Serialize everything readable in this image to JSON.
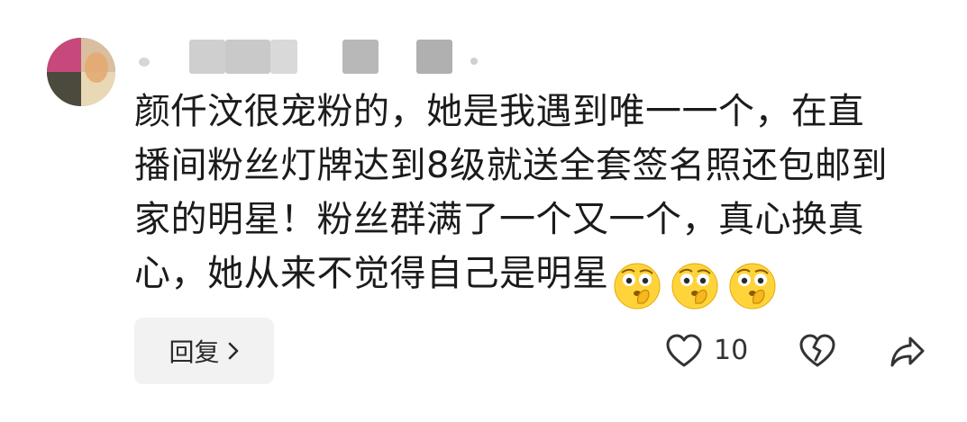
{
  "comment": {
    "lines": [
      "颜仟汶很宠粉的，她是我遇到唯一一个，在直",
      "播间粉丝灯牌达到8级就送全套签名照还包邮到",
      "家的明星！粉丝群满了一个又一个，真心换真",
      "心，她从来不觉得自己是明星"
    ],
    "emojis": [
      "thinking-face-emoji",
      "thinking-face-emoji",
      "thinking-face-emoji"
    ]
  },
  "actions": {
    "reply_label": "回复",
    "like_count": "10",
    "icons": {
      "like": "heart-icon",
      "dislike": "broken-heart-icon",
      "share": "share-arrow-icon",
      "reply_chevron": "chevron-right-icon"
    }
  },
  "colors": {
    "text": "#1b1b1b",
    "reply_bg": "#f2f2f2",
    "icon": "#333333",
    "emoji_face": "#ffd43b"
  }
}
